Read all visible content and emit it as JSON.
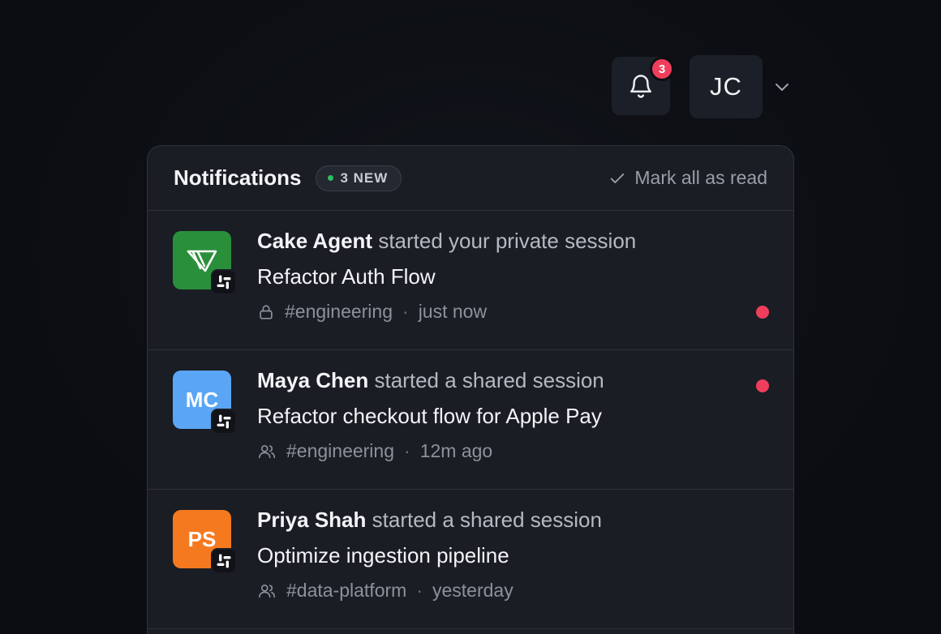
{
  "topbar": {
    "notification_count": "3",
    "user_initials": "JC"
  },
  "panel": {
    "title": "Notifications",
    "new_badge": "3 NEW",
    "mark_all_read": "Mark all as read"
  },
  "notifications": [
    {
      "actor": "Cake Agent",
      "action": "started your private session",
      "session": "Refactor Auth Flow",
      "channel": "#engineering",
      "time": "just now",
      "avatar_initials": "",
      "avatar_color": "#2a8f3b",
      "visibility_icon": "lock-icon",
      "unread": true
    },
    {
      "actor": "Maya Chen",
      "action": "started a shared session",
      "session": "Refactor checkout flow for Apple Pay",
      "channel": "#engineering",
      "time": "12m ago",
      "avatar_initials": "MC",
      "avatar_color": "#5aa6f5",
      "visibility_icon": "users-icon",
      "unread": true
    },
    {
      "actor": "Priya Shah",
      "action": "started a shared session",
      "session": "Optimize ingestion pipeline",
      "channel": "#data-platform",
      "time": "yesterday",
      "avatar_initials": "PS",
      "avatar_color": "#f57a1f",
      "visibility_icon": "users-icon",
      "unread": false
    }
  ],
  "colors": {
    "unread_dot": "#ef3e5c",
    "new_dot": "#2fbf5c",
    "panel_bg": "#1a1d24"
  }
}
